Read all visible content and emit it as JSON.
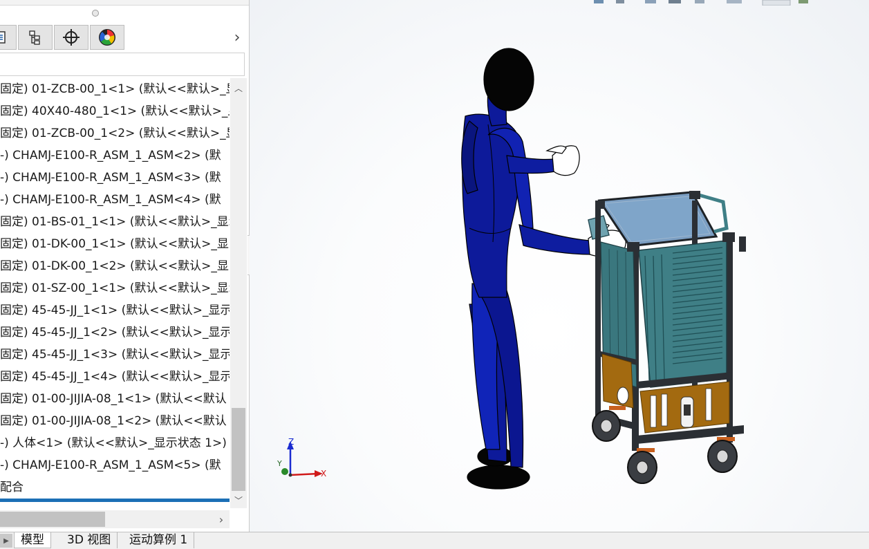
{
  "feature_tree": {
    "rows": [
      "固定) 01-ZCB-00_1<1> (默认<<默认>_显",
      "固定) 40X40-480_1<1> (默认<<默认>_显",
      "固定) 01-ZCB-00_1<2> (默认<<默认>_显",
      "-) CHAMJ-E100-R_ASM_1_ASM<2> (默",
      "-) CHAMJ-E100-R_ASM_1_ASM<3> (默",
      "-) CHAMJ-E100-R_ASM_1_ASM<4> (默",
      "固定) 01-BS-01_1<1> (默认<<默认>_显示",
      "固定) 01-DK-00_1<1> (默认<<默认>_显",
      "固定) 01-DK-00_1<2> (默认<<默认>_显",
      "固定) 01-SZ-00_1<1> (默认<<默认>_显示",
      "固定) 45-45-JJ_1<1> (默认<<默认>_显示",
      "固定) 45-45-JJ_1<2> (默认<<默认>_显示",
      "固定) 45-45-JJ_1<3> (默认<<默认>_显示",
      "固定) 45-45-JJ_1<4> (默认<<默认>_显示",
      "固定) 01-00-JIJIA-08_1<1> (默认<<默认",
      "固定) 01-00-JIJIA-08_1<2> (默认<<默认",
      "-) 人体<1> (默认<<默认>_显示状态 1>)",
      "-) CHAMJ-E100-R_ASM_1_ASM<5> (默",
      "配合"
    ]
  },
  "bottom_tabs": [
    "模型",
    "3D 视图",
    "运动算例 1"
  ],
  "triad": {
    "x": "X",
    "y": "Y",
    "z": "Z"
  },
  "icons": {
    "tabs": [
      "property-manager-icon",
      "configuration-manager-icon",
      "dimxpert-icon",
      "display-manager-icon"
    ],
    "more": "chevron-right-icon"
  },
  "colors": {
    "body_suit": "#0d1a9a",
    "head": "#050505",
    "frame": "#2b2f34",
    "panel": "#3f7f86",
    "wood": "#a36a10",
    "selection": "#1c6fb6"
  }
}
